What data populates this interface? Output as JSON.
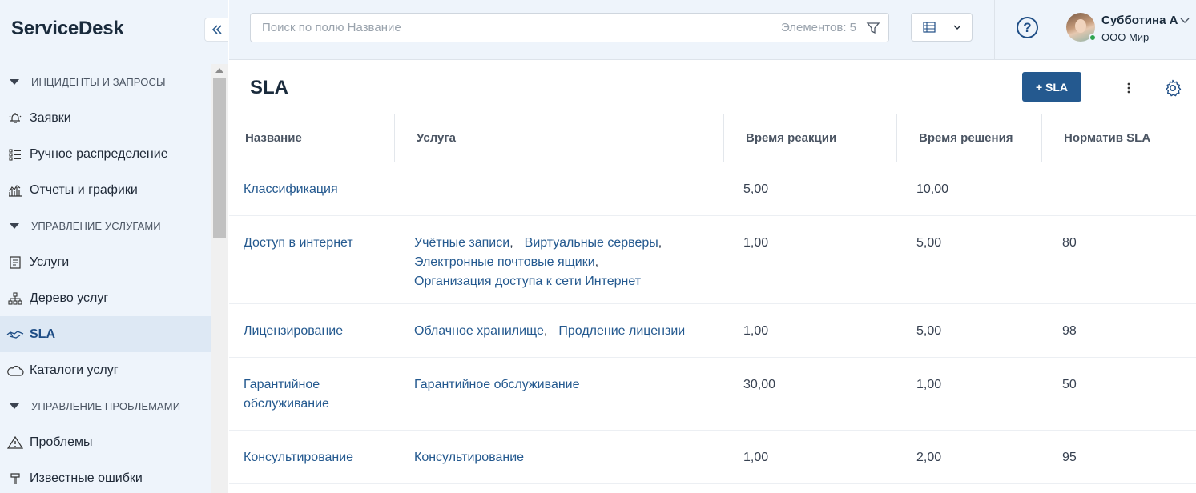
{
  "app": {
    "brand": "ServiceDesk"
  },
  "sidebar": {
    "sections": [
      {
        "label": "ИНЦИДЕНТЫ И ЗАПРОСЫ",
        "items": [
          "Заявки",
          "Ручное распределение",
          "Отчеты и графики"
        ]
      },
      {
        "label": "УПРАВЛЕНИЕ УСЛУГАМИ",
        "items": [
          "Услуги",
          "Дерево услуг",
          "SLA",
          "Каталоги услуг"
        ]
      },
      {
        "label": "УПРАВЛЕНИЕ ПРОБЛЕМАМИ",
        "items": [
          "Проблемы",
          "Известные ошибки"
        ]
      }
    ],
    "active_item": "SLA"
  },
  "search": {
    "placeholder": "Поиск по полю Название",
    "count_label": "Элементов: 5"
  },
  "user": {
    "name": "Субботина А",
    "org": "ООО Мир"
  },
  "page": {
    "title": "SLA",
    "add_button": "+ SLA"
  },
  "table": {
    "columns": [
      "Название",
      "Услуга",
      "Время реакции",
      "Время решения",
      "Норматив SLA"
    ],
    "rows": [
      {
        "name": "Классификация",
        "services": [],
        "reaction": "5,00",
        "resolution": "10,00",
        "norm": ""
      },
      {
        "name": "Доступ в интернет",
        "services": [
          "Учётные записи",
          "Виртуальные серверы",
          "Электронные почтовые ящики",
          "Организация доступа к сети Интернет"
        ],
        "reaction": "1,00",
        "resolution": "5,00",
        "norm": "80"
      },
      {
        "name": "Лицензирование",
        "services": [
          "Облачное хранилище",
          "Продление лицензии"
        ],
        "reaction": "1,00",
        "resolution": "5,00",
        "norm": "98"
      },
      {
        "name": "Гарантийное обслуживание",
        "services": [
          "Гарантийное обслуживание"
        ],
        "reaction": "30,00",
        "resolution": "1,00",
        "norm": "50"
      },
      {
        "name": "Консультирование",
        "services": [
          "Консультирование"
        ],
        "reaction": "1,00",
        "resolution": "2,00",
        "norm": "95"
      }
    ]
  },
  "colors": {
    "accent": "#24598f",
    "sidebar_bg": "#eef4fb",
    "active_bg": "#dde8f4",
    "online": "#2ea44f"
  }
}
